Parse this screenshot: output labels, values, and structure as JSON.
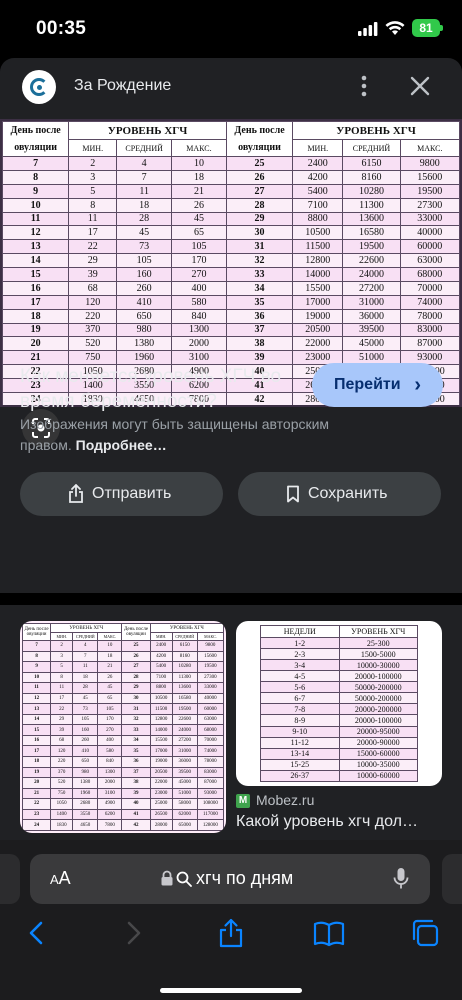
{
  "status_bar": {
    "time": "00:35",
    "battery": "81"
  },
  "sheet": {
    "site_name": "За Рождение",
    "title": "Как меняется уровень ХГЧ во время беременности?",
    "go_button": "Перейти",
    "copyright_text": "Изображения могут быть защищены авторским правом.",
    "copyright_link": "Подробнее…",
    "share_button": "Отправить",
    "save_button": "Сохранить"
  },
  "hcg_table": {
    "headers": {
      "day": "День после овуляции",
      "level": "УРОВЕНЬ ХГЧ",
      "min": "МИН.",
      "avg": "СРЕДНИЙ",
      "max": "МАКС."
    },
    "rows": [
      [
        "7",
        "2",
        "4",
        "10",
        "25",
        "2400",
        "6150",
        "9800"
      ],
      [
        "8",
        "3",
        "7",
        "18",
        "26",
        "4200",
        "8160",
        "15600"
      ],
      [
        "9",
        "5",
        "11",
        "21",
        "27",
        "5400",
        "10280",
        "19500"
      ],
      [
        "10",
        "8",
        "18",
        "26",
        "28",
        "7100",
        "11300",
        "27300"
      ],
      [
        "11",
        "11",
        "28",
        "45",
        "29",
        "8800",
        "13600",
        "33000"
      ],
      [
        "12",
        "17",
        "45",
        "65",
        "30",
        "10500",
        "16580",
        "40000"
      ],
      [
        "13",
        "22",
        "73",
        "105",
        "31",
        "11500",
        "19500",
        "60000"
      ],
      [
        "14",
        "29",
        "105",
        "170",
        "32",
        "12800",
        "22600",
        "63000"
      ],
      [
        "15",
        "39",
        "160",
        "270",
        "33",
        "14000",
        "24000",
        "68000"
      ],
      [
        "16",
        "68",
        "260",
        "400",
        "34",
        "15500",
        "27200",
        "70000"
      ],
      [
        "17",
        "120",
        "410",
        "580",
        "35",
        "17000",
        "31000",
        "74000"
      ],
      [
        "18",
        "220",
        "650",
        "840",
        "36",
        "19000",
        "36000",
        "78000"
      ],
      [
        "19",
        "370",
        "980",
        "1300",
        "37",
        "20500",
        "39500",
        "83000"
      ],
      [
        "20",
        "520",
        "1380",
        "2000",
        "38",
        "22000",
        "45000",
        "87000"
      ],
      [
        "21",
        "750",
        "1960",
        "3100",
        "39",
        "23000",
        "51000",
        "93000"
      ],
      [
        "22",
        "1050",
        "2680",
        "4900",
        "40",
        "25000",
        "58000",
        "108000"
      ],
      [
        "23",
        "1400",
        "3550",
        "6200",
        "41",
        "26500",
        "62000",
        "117000"
      ],
      [
        "24",
        "1830",
        "4650",
        "7800",
        "42",
        "28000",
        "65000",
        "128000"
      ]
    ]
  },
  "weeks_table": {
    "headers": {
      "weeks": "НЕДЕЛИ",
      "level": "УРОВЕНЬ ХГЧ"
    },
    "rows": [
      [
        "1-2",
        "25-300"
      ],
      [
        "2-3",
        "1500-5000"
      ],
      [
        "3-4",
        "10000-30000"
      ],
      [
        "4-5",
        "20000-100000"
      ],
      [
        "5-6",
        "50000-200000"
      ],
      [
        "6-7",
        "50000-200000"
      ],
      [
        "7-8",
        "20000-200000"
      ],
      [
        "8-9",
        "20000-100000"
      ],
      [
        "9-10",
        "20000-95000"
      ],
      [
        "11-12",
        "20000-90000"
      ],
      [
        "13-14",
        "15000-60000"
      ],
      [
        "15-25",
        "10000-35000"
      ],
      [
        "26-37",
        "10000-60000"
      ]
    ]
  },
  "results": {
    "result2_source": "Mobez.ru",
    "result2_favicon": "M",
    "result2_title": "Какой уровень хгч дол…"
  },
  "browser": {
    "text_size_label_small": "A",
    "text_size_label_big": "A",
    "search_query": "хгч по дням"
  }
}
